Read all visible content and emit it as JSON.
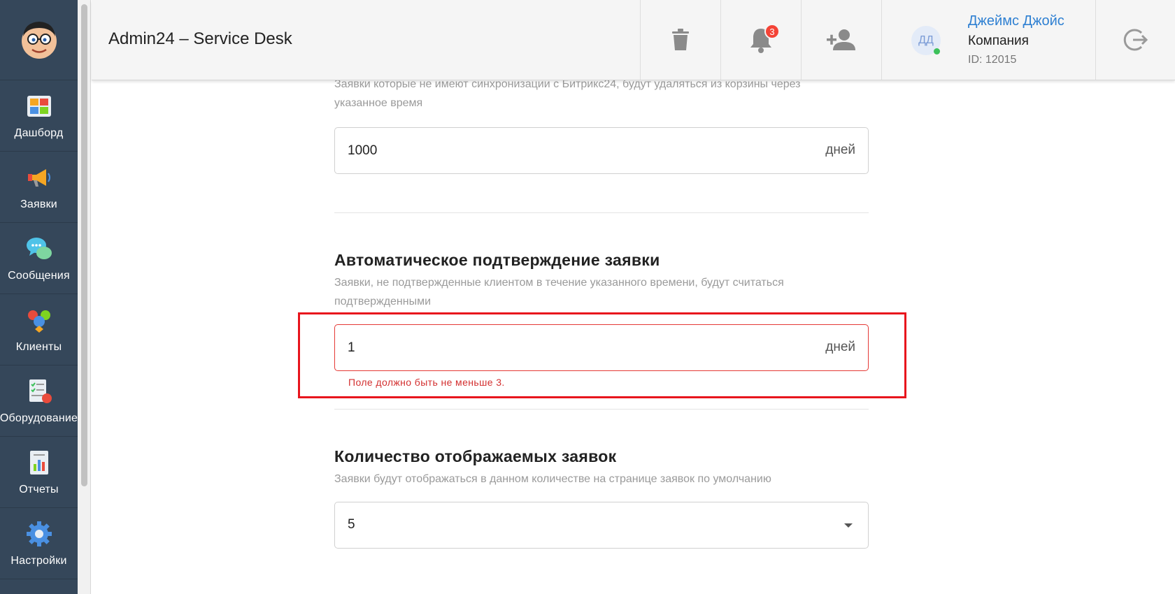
{
  "header": {
    "title": "Admin24 – Service Desk",
    "notifications_count": "3",
    "user": {
      "initials": "ДД",
      "name": "Джеймс Джойс",
      "company": "Компания",
      "id_text": "ID: 12015"
    }
  },
  "sidebar": {
    "items": [
      {
        "label": "Дашборд",
        "icon": "dashboard-icon"
      },
      {
        "label": "Заявки",
        "icon": "megaphone-icon"
      },
      {
        "label": "Сообщения",
        "icon": "chat-bubbles-icon"
      },
      {
        "label": "Клиенты",
        "icon": "clients-icon"
      },
      {
        "label": "Оборудование",
        "icon": "equipment-checklist-icon"
      },
      {
        "label": "Отчеты",
        "icon": "report-chart-icon"
      },
      {
        "label": "Настройки",
        "icon": "gear-icon"
      }
    ]
  },
  "settings": {
    "trash": {
      "description": "Заявки которые не имеют синхронизации с Битрикс24, будут удаляться из корзины через указанное время",
      "value": "1000",
      "unit": "дней"
    },
    "auto_confirm": {
      "title": "Автоматическое подтверждение заявки",
      "description": "Заявки, не подтвержденные клиентом в течение указанного времени, будут считаться подтвержденными",
      "value": "1",
      "unit": "дней",
      "error": "Поле должно быть не меньше 3."
    },
    "display_count": {
      "title": "Количество отображаемых заявок",
      "description": "Заявки будут отображаться в данном количестве на странице заявок по умолчанию",
      "value": "5"
    }
  },
  "colors": {
    "sidebar_bg": "#35475a",
    "accent_blue": "#2f80d2",
    "error_red": "#e53935",
    "badge_red": "#f44336"
  }
}
